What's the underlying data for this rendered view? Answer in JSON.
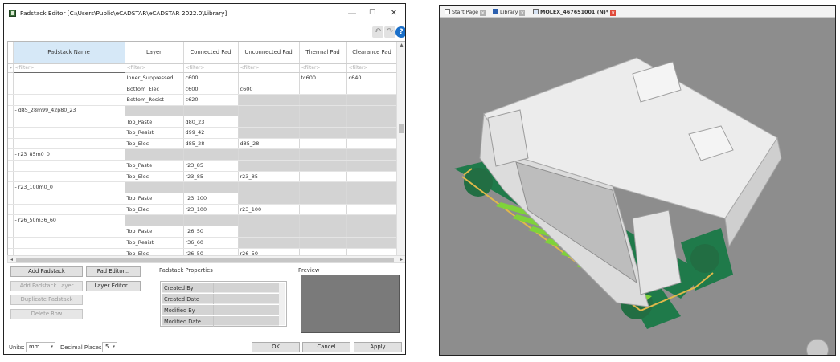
{
  "editor": {
    "title": "Padstack Editor [C:\\Users\\Public\\eCADSTAR\\eCADSTAR 2022.0\\Library]",
    "window_buttons": {
      "minimize": "—",
      "maximize": "☐",
      "close": "✕"
    },
    "toolbar": {
      "undo": "↶",
      "redo": "↷",
      "help": "?"
    },
    "columns": [
      "Padstack Name",
      "Layer",
      "Connected Pad",
      "Unconnected Pad",
      "Thermal Pad",
      "Clearance Pad"
    ],
    "filter": "<filter>",
    "rows": [
      {
        "name": "",
        "layer": "Inner_Suppressed",
        "connected": "c600",
        "unconnected": "",
        "thermal": "tc600",
        "clearance": "c640",
        "gray": false
      },
      {
        "name": "",
        "layer": "Bottom_Elec",
        "connected": "c600",
        "unconnected": "c600",
        "thermal": "",
        "clearance": "",
        "gray": false
      },
      {
        "name": "",
        "layer": "Bottom_Resist",
        "connected": "c620",
        "unconnected": "",
        "thermal": "",
        "clearance": "",
        "gray": true
      },
      {
        "name": "- d85_28m99_42p80_23",
        "layer": "",
        "connected": "",
        "unconnected": "",
        "thermal": "",
        "clearance": "",
        "group": true
      },
      {
        "name": "",
        "layer": "Top_Paste",
        "connected": "d80_23",
        "unconnected": "",
        "thermal": "",
        "clearance": "",
        "gray": true
      },
      {
        "name": "",
        "layer": "Top_Resist",
        "connected": "d99_42",
        "unconnected": "",
        "thermal": "",
        "clearance": "",
        "gray": true
      },
      {
        "name": "",
        "layer": "Top_Elec",
        "connected": "d85_28",
        "unconnected": "d85_28",
        "thermal": "",
        "clearance": "",
        "gray": false
      },
      {
        "name": "- r23_85m0_0",
        "layer": "",
        "connected": "",
        "unconnected": "",
        "thermal": "",
        "clearance": "",
        "group": true
      },
      {
        "name": "",
        "layer": "Top_Paste",
        "connected": "r23_85",
        "unconnected": "",
        "thermal": "",
        "clearance": "",
        "gray": true
      },
      {
        "name": "",
        "layer": "Top_Elec",
        "connected": "r23_85",
        "unconnected": "r23_85",
        "thermal": "",
        "clearance": "",
        "gray": false
      },
      {
        "name": "- r23_100m0_0",
        "layer": "",
        "connected": "",
        "unconnected": "",
        "thermal": "",
        "clearance": "",
        "group": true
      },
      {
        "name": "",
        "layer": "Top_Paste",
        "connected": "r23_100",
        "unconnected": "",
        "thermal": "",
        "clearance": "",
        "gray": true
      },
      {
        "name": "",
        "layer": "Top_Elec",
        "connected": "r23_100",
        "unconnected": "r23_100",
        "thermal": "",
        "clearance": "",
        "gray": false
      },
      {
        "name": "- r26_50m36_60",
        "layer": "",
        "connected": "",
        "unconnected": "",
        "thermal": "",
        "clearance": "",
        "group": true
      },
      {
        "name": "",
        "layer": "Top_Paste",
        "connected": "r26_50",
        "unconnected": "",
        "thermal": "",
        "clearance": "",
        "gray": true
      },
      {
        "name": "",
        "layer": "Top_Resist",
        "connected": "r36_60",
        "unconnected": "",
        "thermal": "",
        "clearance": "",
        "gray": true
      },
      {
        "name": "",
        "layer": "Top_Elec",
        "connected": "r26_50",
        "unconnected": "r26_50",
        "thermal": "",
        "clearance": "",
        "gray": false
      }
    ],
    "buttons": {
      "add_padstack": "Add Padstack",
      "pad_editor": "Pad Editor...",
      "add_padstack_layer": "Add Padstack Layer",
      "layer_editor": "Layer Editor...",
      "duplicate_padstack": "Duplicate Padstack",
      "delete_row": "Delete Row",
      "ok": "OK",
      "cancel": "Cancel",
      "apply": "Apply"
    },
    "properties": {
      "label": "Padstack Properties",
      "fields": [
        "Created By",
        "Created Date",
        "Modified By",
        "Modified Date"
      ]
    },
    "preview_label": "Preview",
    "status": {
      "units_label": "Units:",
      "units_value": "mm",
      "decimal_label": "Decimal Places:",
      "decimal_value": "5"
    }
  },
  "viewer": {
    "tabs": [
      {
        "label": "Start Page",
        "icon": "home-icon"
      },
      {
        "label": "Library",
        "icon": "library-icon"
      },
      {
        "label": "MOLEX_467651001 (N)*",
        "icon": "footprint-icon"
      }
    ],
    "colors": {
      "background": "#8d8d8d",
      "body": "#e9e9e9",
      "board": "#1f7a4a",
      "pins": "#7fd23a",
      "pin_tips": "#2a5fae",
      "outline": "#e0b84a"
    }
  }
}
